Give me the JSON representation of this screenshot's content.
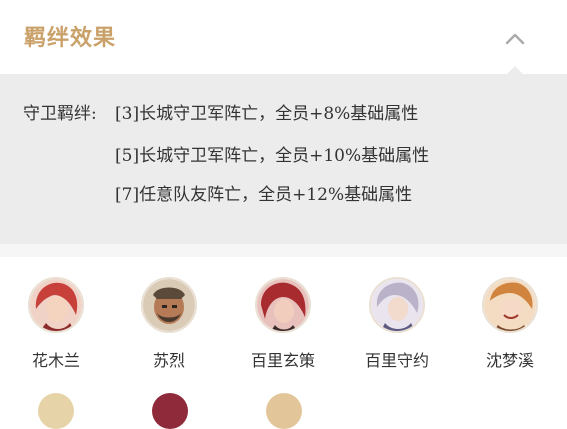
{
  "header": {
    "title": "羁绊效果",
    "collapse_icon": "chevron-up-icon"
  },
  "bond": {
    "label": "守卫羁绊:",
    "effects": [
      "[3]长城守卫军阵亡，全员+8%基础属性",
      "[5]长城守卫军阵亡，全员+10%基础属性",
      "[7]任意队友阵亡，全员+12%基础属性"
    ]
  },
  "heroes": [
    {
      "name": "花木兰"
    },
    {
      "name": "苏烈"
    },
    {
      "name": "百里玄策"
    },
    {
      "name": "百里守约"
    },
    {
      "name": "沈梦溪"
    }
  ],
  "colors": {
    "accent": "#c9a169",
    "panel_bg": "#ececec",
    "text": "#333333"
  }
}
